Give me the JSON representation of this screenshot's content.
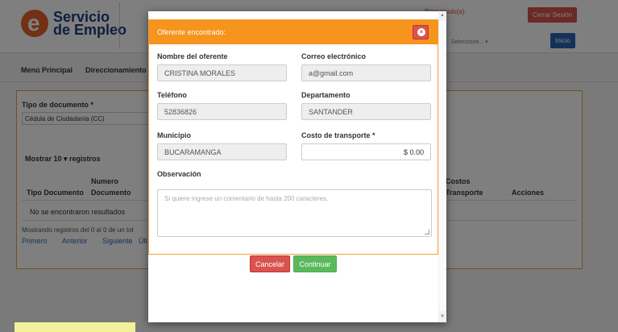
{
  "header": {
    "logo_line1": "Servicio",
    "logo_line2": "de Empleo",
    "logo_letter": "e",
    "welcome": "Bienvenido(a):",
    "logout_label": "Cerrar Sesión",
    "select_placeholder": "Seleccione... ▾",
    "home_label": "Inicio"
  },
  "menu": {
    "items": [
      "Menú Principal",
      "Direccionamiento"
    ]
  },
  "filter": {
    "doc_type_label": "Tipo de documento *",
    "doc_type_value": "Cédula de Ciudadanía (CC)"
  },
  "table": {
    "show_label": "Mostrar 10 ▾ registros",
    "headers": {
      "tipo_doc": "Tipo Documento",
      "num_doc_1": "Numero",
      "num_doc_2": "Documento",
      "costos_1": "Costos",
      "costos_2": "Transporte",
      "acciones": "Acciones"
    },
    "empty": "No se encontraron resultados",
    "summary": "Mostrando registros del 0 al 0 de un tot",
    "pager": [
      "Primero",
      "Anterior",
      "Siguiente",
      "Últ"
    ]
  },
  "modal": {
    "title": "Oferente encontrado:",
    "close_icon": "close-circle-icon",
    "fields": {
      "nombre_label": "Nombre del oferente",
      "nombre_value": "CRISTINA  MORALES",
      "correo_label": "Correo electrónico",
      "correo_value": "a@gmail.com",
      "telefono_label": "Teléfono",
      "telefono_value": "52836826",
      "departamento_label": "Departamento",
      "departamento_value": "SANTANDER",
      "municipio_label": "Municipio",
      "municipio_value": "BUCARAMANGA",
      "costo_label": "Costo de transporte *",
      "costo_value": "$ 0.00",
      "observacion_label": "Observación",
      "observacion_placeholder": "Si quiere ingrese un comentario de hasta 200 caracteres."
    },
    "cancel_label": "Cancelar",
    "continue_label": "Continuar"
  },
  "colors": {
    "modal_header": "#f7941d",
    "danger": "#d9534f",
    "success": "#5cb85c",
    "primary": "#2a62b5"
  }
}
